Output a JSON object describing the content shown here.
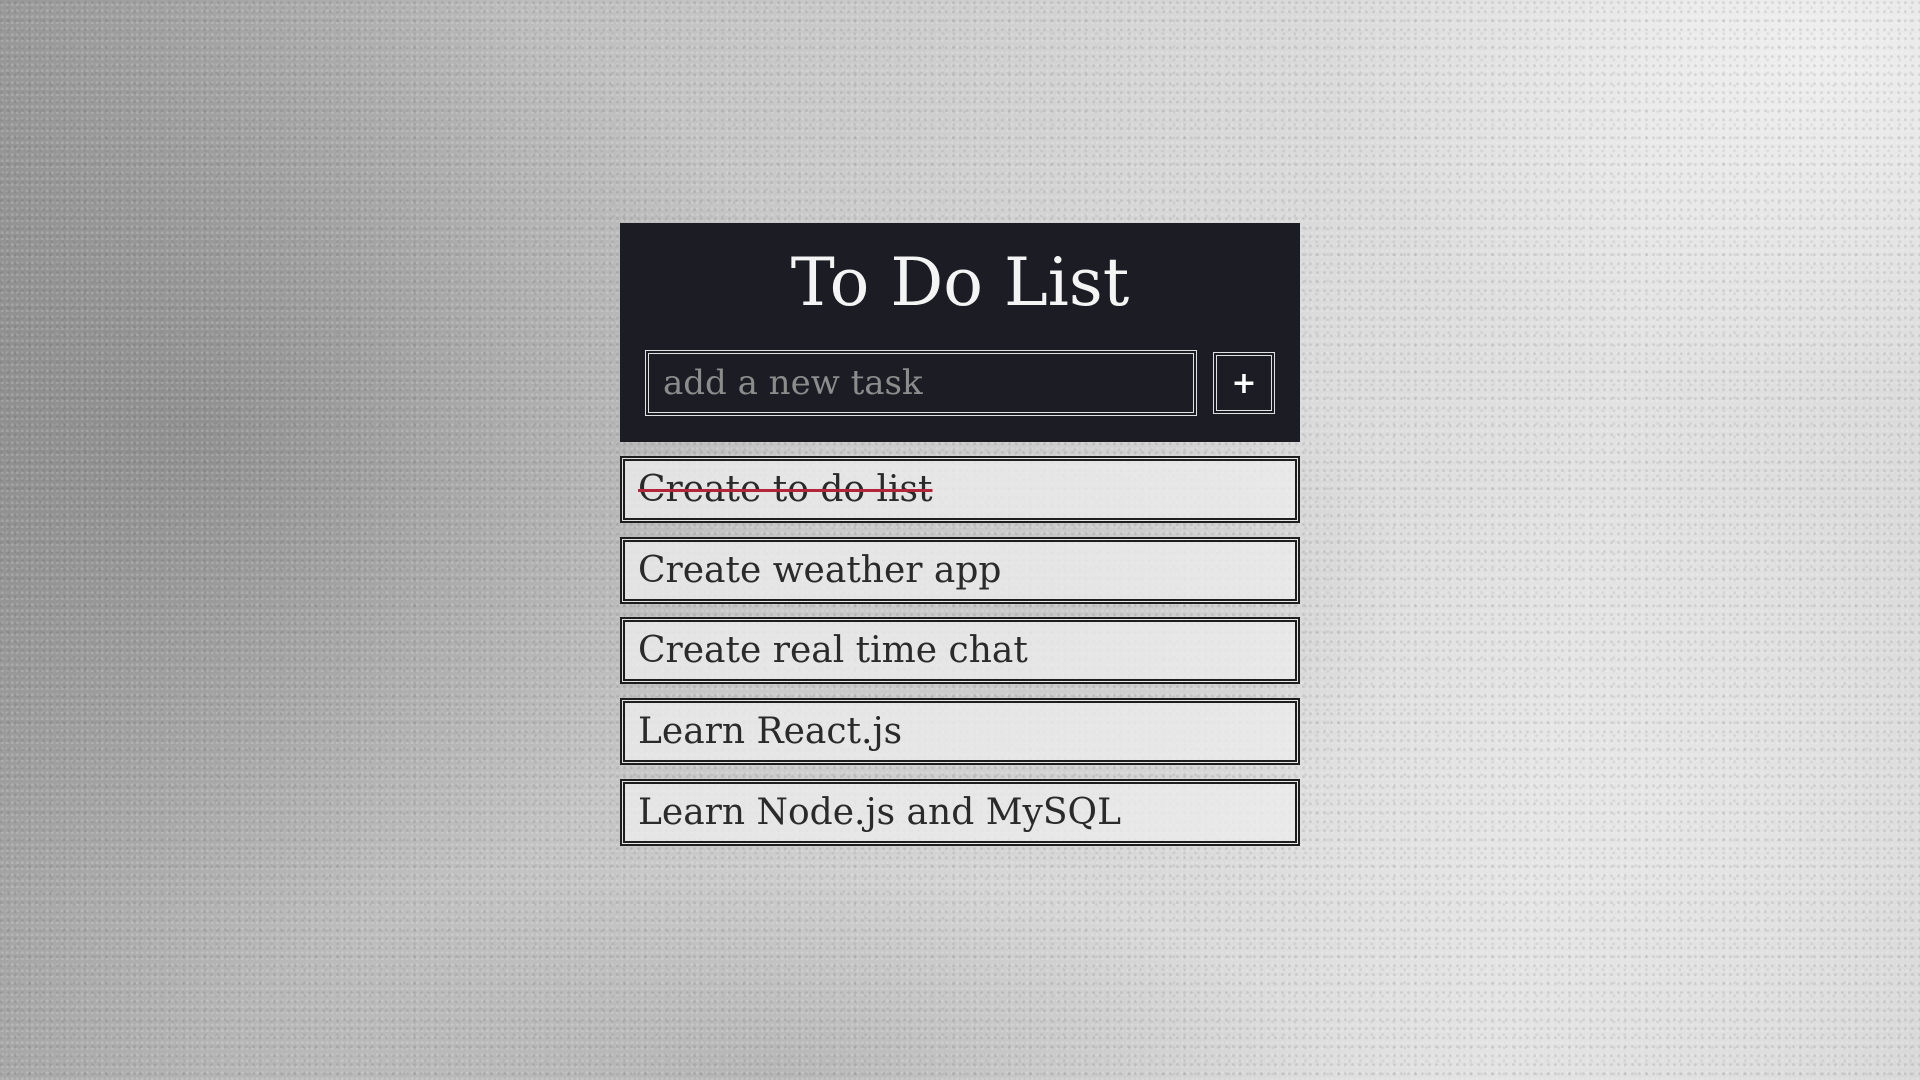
{
  "app": {
    "title": "To Do List"
  },
  "new_task": {
    "placeholder": "add a new task",
    "value": "",
    "add_button_label": "+"
  },
  "tasks": [
    {
      "text": "Create to do list",
      "completed": true
    },
    {
      "text": "Create weather app",
      "completed": false
    },
    {
      "text": "Create real time chat",
      "completed": false
    },
    {
      "text": "Learn React.js",
      "completed": false
    },
    {
      "text": "Learn Node.js and MySQL",
      "completed": false
    }
  ],
  "colors": {
    "header_background": "#1c1d24",
    "completed_strike": "#b3253a",
    "item_border": "#1e1e1e"
  }
}
